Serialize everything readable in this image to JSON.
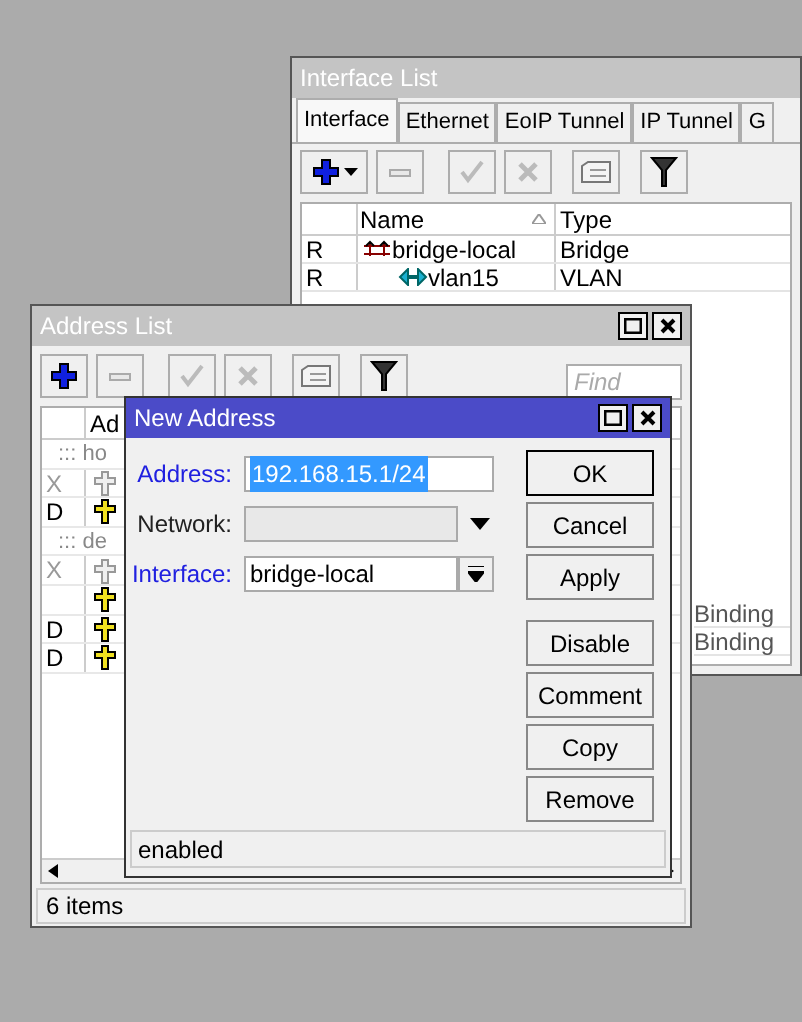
{
  "interface_list": {
    "title": "Interface List",
    "tabs": [
      {
        "label": "Interface",
        "selected": true
      },
      {
        "label": "Ethernet",
        "selected": false
      },
      {
        "label": "EoIP Tunnel",
        "selected": false
      },
      {
        "label": "IP Tunnel",
        "selected": false
      },
      {
        "label": "G",
        "selected": false
      }
    ],
    "columns": [
      "Name",
      "Type"
    ],
    "rows": [
      {
        "flag": "R",
        "kind": "bridge",
        "name": "bridge-local",
        "type": "Bridge"
      },
      {
        "flag": "R",
        "kind": "vlan",
        "name": "vlan15",
        "type": "VLAN"
      }
    ],
    "partly_hidden_cells_column_3": [
      "Binding",
      "Binding"
    ]
  },
  "address_list": {
    "title": "Address List",
    "find_placeholder": "Find",
    "column_1": "Ad",
    "rows": [
      {
        "kind": "comment",
        "text": "::: ho"
      },
      {
        "kind": "entry",
        "flag": "X",
        "disabled": true
      },
      {
        "kind": "entry",
        "flag": "D",
        "disabled": false
      },
      {
        "kind": "comment",
        "text": "::: de"
      },
      {
        "kind": "entry",
        "flag": "X",
        "disabled": true
      },
      {
        "kind": "entry",
        "disabled": false
      },
      {
        "kind": "entry",
        "flag": "D",
        "disabled": false
      },
      {
        "kind": "entry",
        "flag": "D",
        "disabled": false
      }
    ],
    "status": "6 items"
  },
  "new_address": {
    "title": "New Address",
    "fields": [
      {
        "label": "Address:",
        "kind": "text",
        "value": "192.168.15.1/24",
        "required": true,
        "text_selected": true
      },
      {
        "label": "Network:",
        "kind": "dropdown",
        "required": false
      },
      {
        "label": "Interface:",
        "kind": "select",
        "value": "bridge-local",
        "required": true,
        "text_selected": false
      }
    ],
    "buttons": [
      "OK",
      "Cancel",
      "Apply",
      "Disable",
      "Comment",
      "Copy",
      "Remove"
    ],
    "status": "enabled"
  }
}
